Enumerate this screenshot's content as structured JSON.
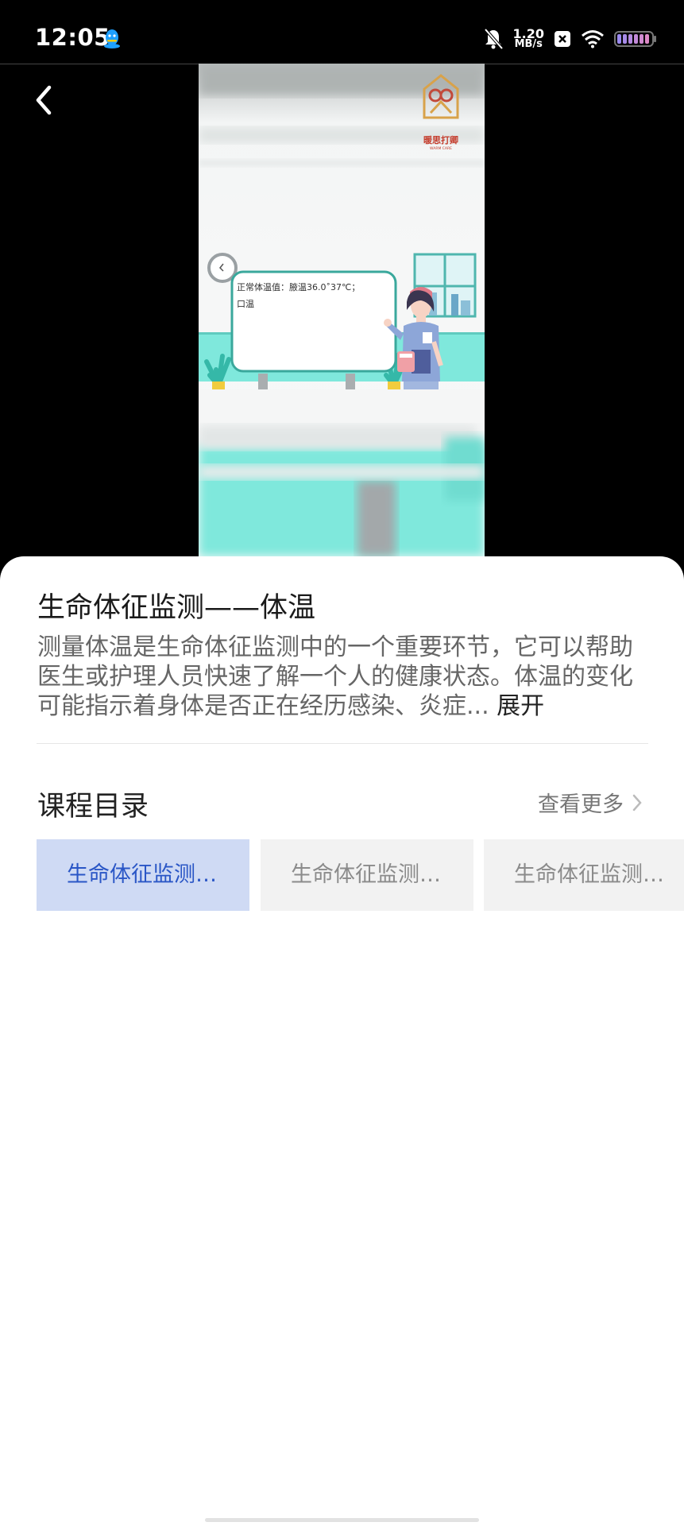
{
  "status_bar": {
    "time": "12:05",
    "net_speed_value": "1.20",
    "net_speed_unit": "MB/s",
    "icons": [
      "qq-icon",
      "mute-bell-icon",
      "close-box-icon",
      "wifi-icon",
      "battery-icon"
    ]
  },
  "video": {
    "brand_text": "暖思打卿",
    "brand_subtext": "WARM CARE",
    "board_text_line1": "正常体温值：腋温36.0˚37℃；",
    "board_text_line2": "口温"
  },
  "course": {
    "title": "生命体征监测——体温",
    "description": "测量体温是生命体征监测中的一个重要环节，它可以帮助医生或护理人员快速了解一个人的健康状态。体温的变化可能指示着身体是否正在经历感染、炎症...",
    "expand_label": "展开"
  },
  "catalog": {
    "title": "课程目录",
    "see_more": "查看更多",
    "chapters": [
      {
        "label": "生命体征监测…",
        "active": true
      },
      {
        "label": "生命体征监测…",
        "active": false
      },
      {
        "label": "生命体征监测…",
        "active": false
      }
    ]
  },
  "colors": {
    "accent_blue": "#2a56c6",
    "active_chip_bg": "#cfdaf4",
    "teal": "#6fe3d6"
  }
}
